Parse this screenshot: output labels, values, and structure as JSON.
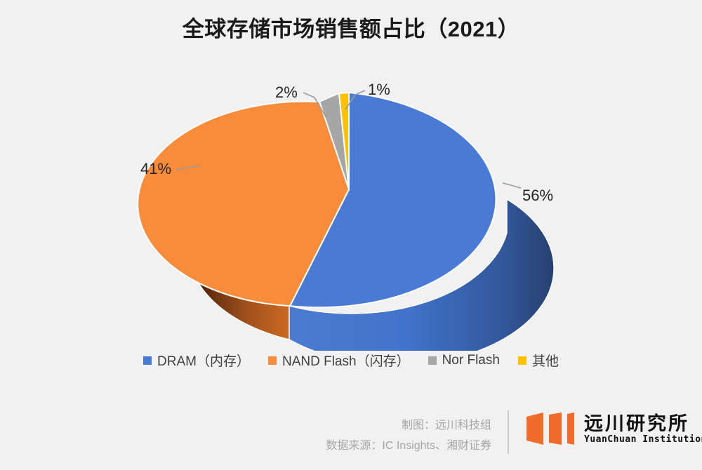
{
  "chart_data": {
    "type": "pie",
    "title": "全球存储市场销售额占比（2021）",
    "categories": [
      "DRAM（内存）",
      "NAND Flash（闪存）",
      "Nor Flash",
      "其他"
    ],
    "values": [
      56,
      41,
      2,
      1
    ],
    "value_labels": [
      "56%",
      "41%",
      "2%",
      "1%"
    ],
    "unit": "%",
    "colors": [
      "#4a7bd4",
      "#f98c3a",
      "#a6a6a6",
      "#ffc000"
    ],
    "legend_position": "bottom",
    "grid": false,
    "three_d": true,
    "xlabel": "",
    "ylabel": ""
  },
  "title": "全球存储市场销售额占比（2021）",
  "labels": {
    "dram": "56%",
    "nand": "41%",
    "nor": "2%",
    "other": "1%"
  },
  "legend": {
    "items": [
      {
        "label": "DRAM（内存）",
        "color": "#4a7bd4"
      },
      {
        "label": "NAND Flash（闪存）",
        "color": "#f98c3a"
      },
      {
        "label": "Nor Flash",
        "color": "#a6a6a6"
      },
      {
        "label": "其他",
        "color": "#ffc000"
      }
    ]
  },
  "footer": {
    "credit": "制图：远川科技组",
    "source": "数据来源：IC Insights、湘财证券",
    "brand_cn": "远川研究所",
    "brand_en": "YuanChuan Institution"
  },
  "theme": {
    "background": "#f1f1f1",
    "title_color": "#1a1a1a",
    "label_color": "#262626",
    "legend_text_color": "#404040",
    "footer_text_color": "#a6a6a6",
    "brand_orange": "#ef6c2a"
  }
}
